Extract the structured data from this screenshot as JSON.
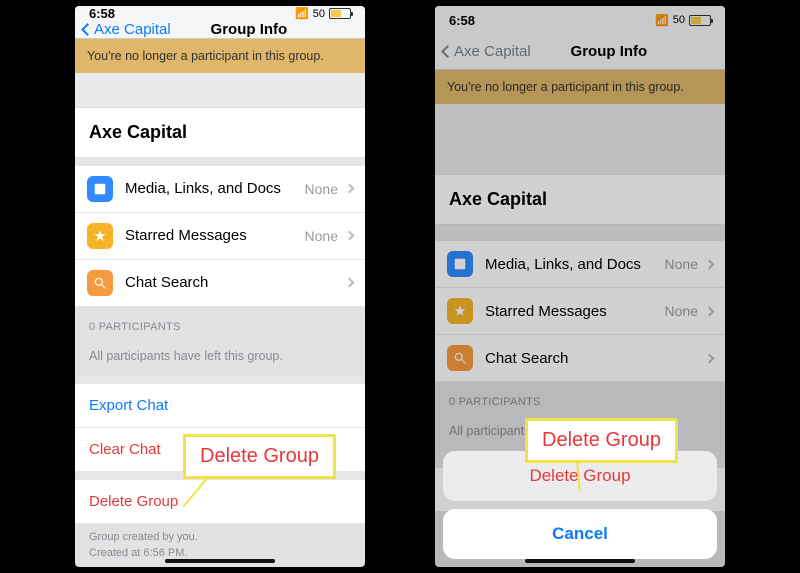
{
  "status": {
    "time": "6:58",
    "batt": "50"
  },
  "nav": {
    "back": "Axe Capital",
    "title": "Group Info"
  },
  "banner": "You're no longer a participant in this group.",
  "group": "Axe Capital",
  "rows": {
    "media": {
      "label": "Media, Links, and Docs",
      "value": "None"
    },
    "starred": {
      "label": "Starred Messages",
      "value": "None"
    },
    "search": {
      "label": "Chat Search"
    }
  },
  "participants": {
    "header": "0 PARTICIPANTS",
    "note": "All participants have left this group."
  },
  "actions": {
    "export": "Export Chat",
    "clear": "Clear Chat",
    "delete": "Delete Group"
  },
  "footer": {
    "l1": "Group created by you.",
    "l2": "Created at 6:56 PM."
  },
  "callout": "Delete Group",
  "sheet": {
    "delete": "Delete Group",
    "cancel": "Cancel"
  }
}
